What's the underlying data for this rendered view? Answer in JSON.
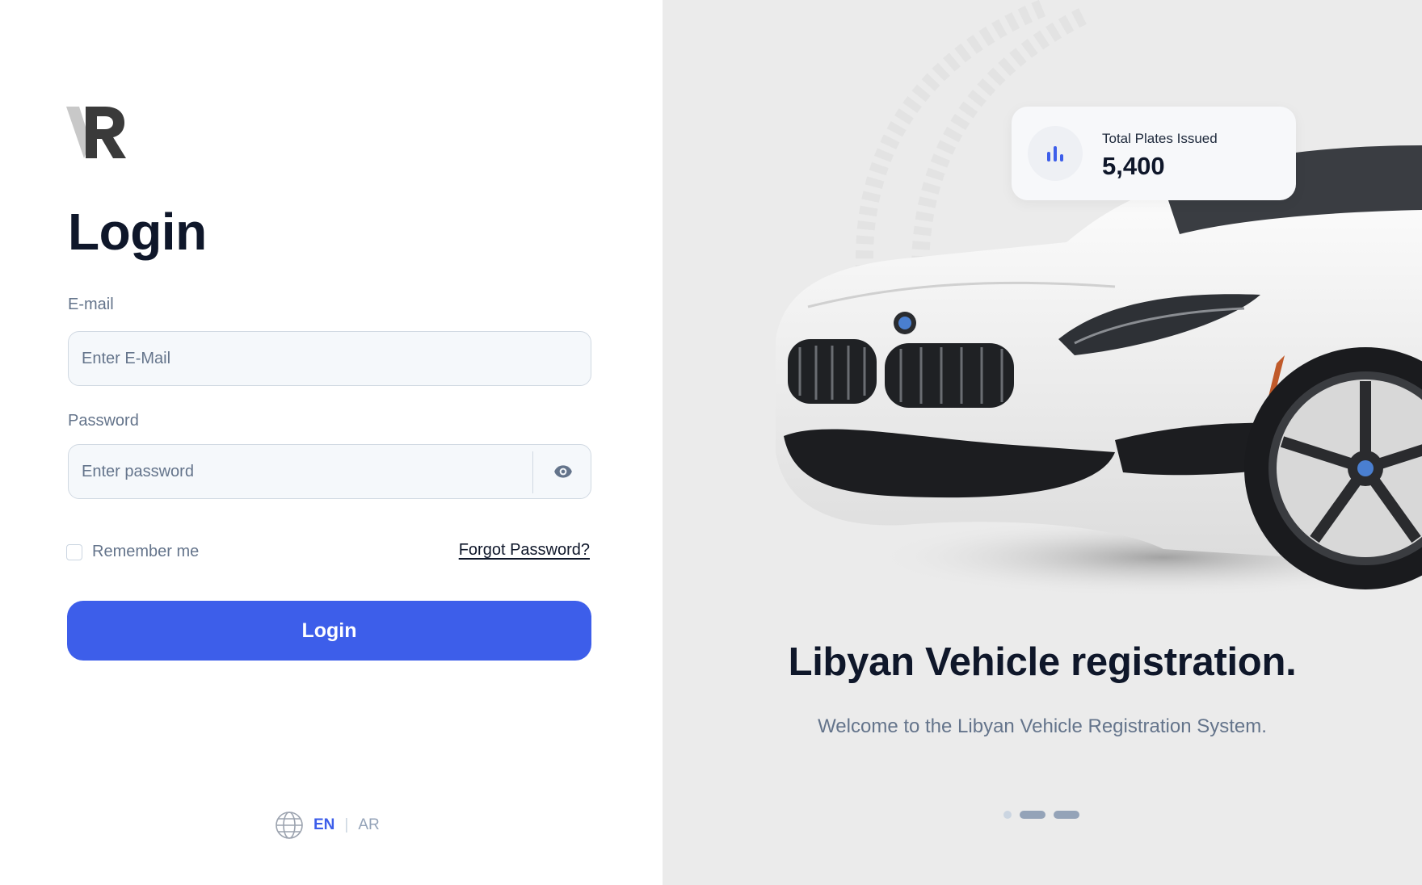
{
  "login": {
    "title": "Login",
    "email_label": "E-mail",
    "email_placeholder": "Enter E-Mail",
    "password_label": "Password",
    "password_placeholder": "Enter password",
    "remember_label": "Remember me",
    "forgot_label": "Forgot Password?",
    "submit_label": "Login"
  },
  "language": {
    "icon": "globe-icon",
    "current": "EN",
    "separator": "|",
    "other": "AR"
  },
  "hero": {
    "stat_label": "Total Plates Issued",
    "stat_value": "5,400",
    "stat_icon": "bar-chart-icon",
    "headline": "Libyan Vehicle registration.",
    "subline": "Welcome to the Libyan Vehicle Registration System.",
    "carousel_slides": 3,
    "carousel_active_index": 0
  },
  "colors": {
    "primary": "#3d5eea",
    "heading": "#0f172a",
    "muted": "#64748b",
    "panel_bg": "#ebebeb"
  }
}
